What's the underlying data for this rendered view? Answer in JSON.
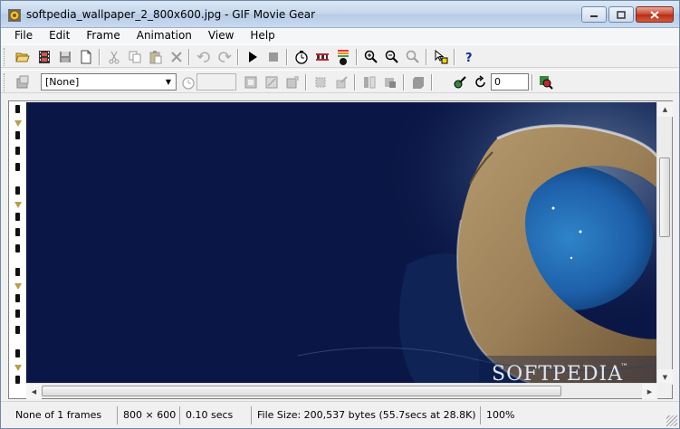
{
  "window": {
    "title": "softpedia_wallpaper_2_800x600.jpg - GIF Movie Gear"
  },
  "menu": [
    "File",
    "Edit",
    "Frame",
    "Animation",
    "View",
    "Help"
  ],
  "toolbar2": {
    "palette_value": "[None]",
    "delay_value": "",
    "loop_value": "0"
  },
  "image": {
    "watermark": "SOFTPEDIA",
    "trademark": "™"
  },
  "status": {
    "frames": "None of 1 frames",
    "dimensions": "800 × 600",
    "delay": "0.10 secs",
    "filesize": "File Size: 200,537 bytes  (55.7secs at 28.8K)",
    "zoom": "100%"
  },
  "colors": {
    "sky": "#0a1746",
    "sea": "#1d5fa8",
    "island": "#9c8058"
  }
}
